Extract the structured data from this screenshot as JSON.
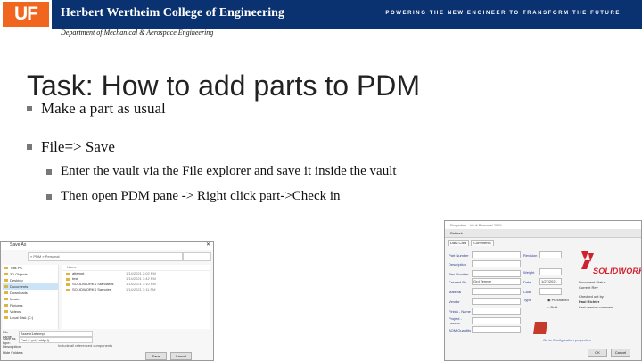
{
  "header": {
    "logo": "UF",
    "college": "Herbert Wertheim College of Engineering",
    "tagline": "POWERING THE NEW ENGINEER TO TRANSFORM THE FUTURE",
    "department": "Department of Mechanical & Aerospace Engineering",
    "colors": {
      "bar": "#0a3170",
      "logo": "#f0661f"
    }
  },
  "slide": {
    "title": "Task: How to add parts to PDM",
    "bullets": [
      {
        "text": "Make a part as usual",
        "level": 1
      },
      {
        "text": "File=> Save",
        "level": 1
      },
      {
        "text": "Enter the vault via the File explorer and save it inside the vault",
        "level": 2
      },
      {
        "text": "Then open PDM pane -> Right click part->Check in",
        "level": 2
      }
    ]
  },
  "save_dialog": {
    "title": "Save As",
    "address": "« PDM » Personal",
    "sidebar": [
      "This PC",
      "3D Objects",
      "Desktop",
      "Documents",
      "Downloads",
      "Music",
      "Pictures",
      "Videos",
      "Local Disk (C:)"
    ],
    "selected_sidebar_index": 3,
    "header_name": "Name",
    "files": [
      {
        "name": "attempt",
        "date": "1/14/2021 2:02 PM"
      },
      {
        "name": "test",
        "date": "1/14/2021 1:42 PM"
      },
      {
        "name": "SOLIDWORKS Standards",
        "date": "1/14/2021 3:10 PM"
      },
      {
        "name": "SOLIDWORKS Samples",
        "date": "1/14/2021 3:11 PM"
      }
    ],
    "file_name_label": "File name:",
    "file_name_value": "Assem1attempt",
    "save_type_label": "Save as type:",
    "save_type_value": "Part (*.prt;*.sldprt)",
    "description_label": "Description:",
    "description_value": "Include all referenced components",
    "hide_folders": "Hide Folders",
    "save_button": "Save",
    "cancel_button": "Cancel"
  },
  "properties_form": {
    "title": "Properties - Vault Personal 2019",
    "toolbar": "Refresh",
    "tabs": [
      "Data Card",
      "Comments"
    ],
    "fields_left": [
      {
        "label": "Part Number",
        "value": ""
      },
      {
        "label": "Description",
        "value": ""
      },
      {
        "label": "Rev Number",
        "value": ""
      },
      {
        "label": "Created By",
        "value": "Grd Tenner"
      },
      {
        "label": "Material",
        "value": ""
      },
      {
        "label": "Vendor",
        "value": ""
      },
      {
        "label": "Finish - Name",
        "value": ""
      },
      {
        "label": "Project - Lesson",
        "value": ""
      },
      {
        "label": "BOM Quantity",
        "value": ""
      }
    ],
    "fields_right": [
      {
        "label": "Revision",
        "value": ""
      },
      {
        "label": "Weight",
        "value": ""
      },
      {
        "label": "Date",
        "value": "1/27/2021"
      },
      {
        "label": "Cost",
        "value": ""
      },
      {
        "label": "Type",
        "value": ""
      }
    ],
    "radios": [
      "Purchased",
      "Built"
    ],
    "brand": "SOLIDWORKS",
    "info": [
      "Document Status",
      "Current Rev",
      "Checked out by",
      "Paul Richter",
      "Last version comment"
    ],
    "footer_link": "Go to Configuration properties",
    "ok_button": "OK",
    "cancel_button": "Cancel"
  }
}
